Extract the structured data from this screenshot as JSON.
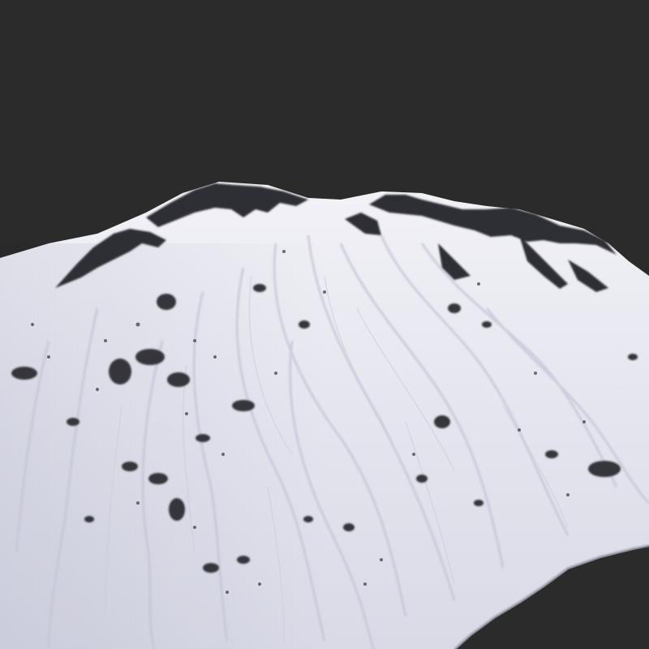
{
  "scene": {
    "subject": "snow-covered-mountain-terrain-render",
    "background_color": "#2b2b2b",
    "snow_color": "#e6e6ee",
    "snow_shadow_color": "#c6c8d6",
    "rock_color": "#2a2a2e"
  }
}
